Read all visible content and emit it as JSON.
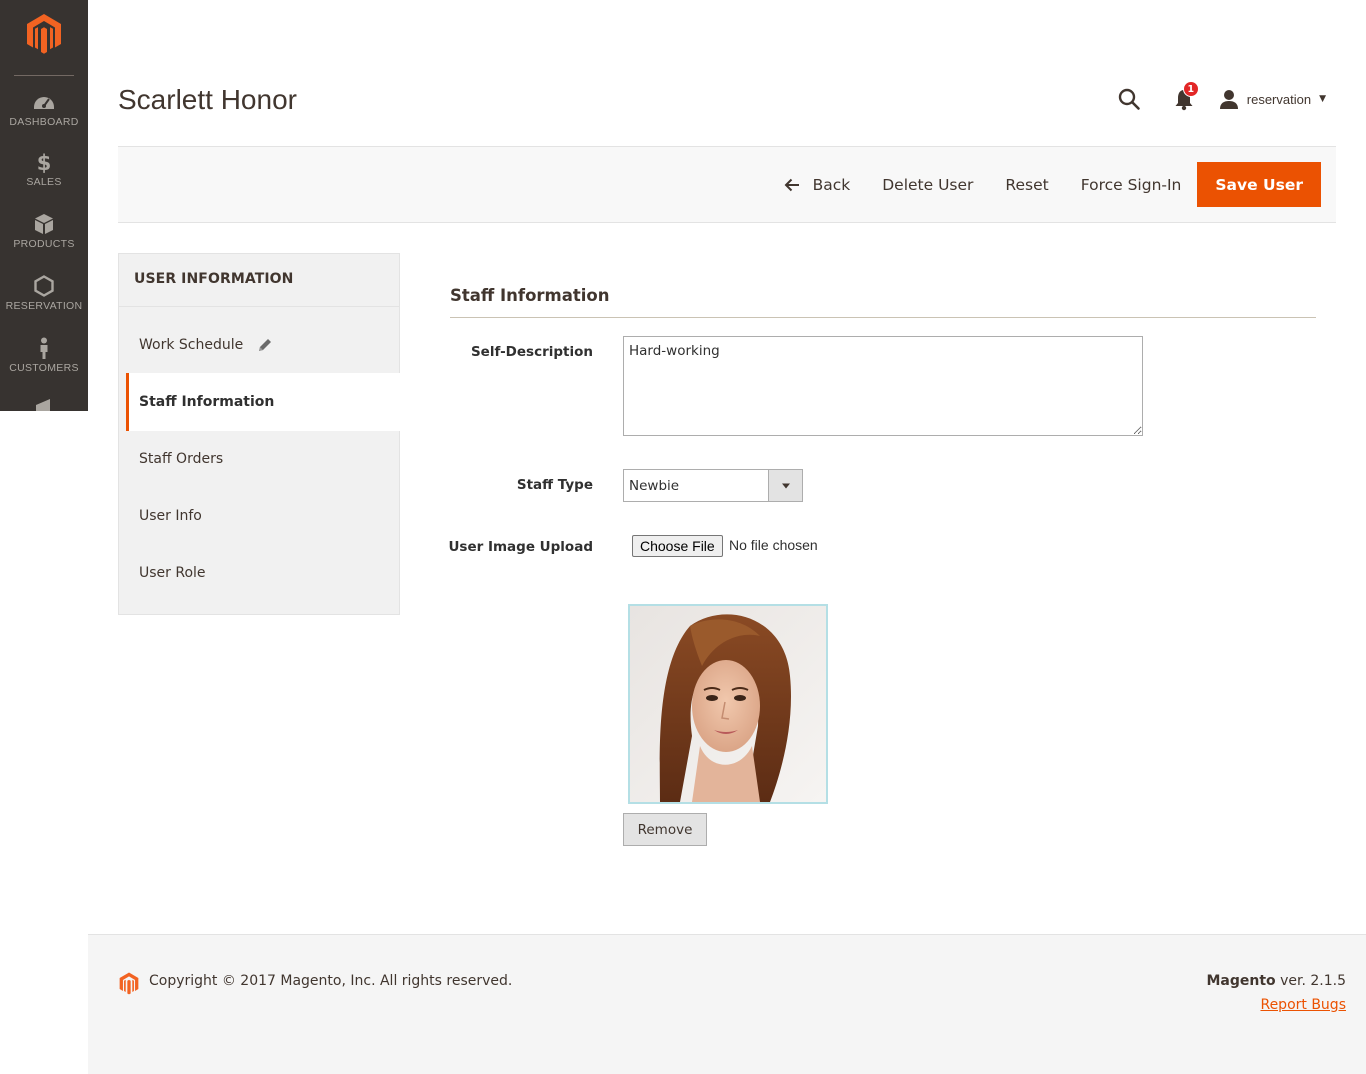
{
  "sidebar": {
    "items": [
      {
        "label": "DASHBOARD",
        "icon": "speedometer-icon"
      },
      {
        "label": "SALES",
        "icon": "dollar-icon"
      },
      {
        "label": "PRODUCTS",
        "icon": "box-icon"
      },
      {
        "label": "RESERVATION",
        "icon": "hexagon-icon"
      },
      {
        "label": "CUSTOMERS",
        "icon": "person-icon"
      }
    ]
  },
  "header": {
    "title": "Scarlett Honor",
    "notification_count": "1",
    "username": "reservation"
  },
  "actions": {
    "back": "Back",
    "delete": "Delete User",
    "reset": "Reset",
    "force_signin": "Force Sign-In",
    "save": "Save User"
  },
  "tabs": {
    "title": "USER INFORMATION",
    "items": [
      {
        "label": "Work Schedule"
      },
      {
        "label": "Staff Information"
      },
      {
        "label": "Staff Orders"
      },
      {
        "label": "User Info"
      },
      {
        "label": "User Role"
      }
    ]
  },
  "form": {
    "section_title": "Staff Information",
    "self_description_label": "Self-Description",
    "self_description_value": "Hard-working",
    "staff_type_label": "Staff Type",
    "staff_type_value": "Newbie",
    "image_upload_label": "User Image Upload",
    "choose_file": "Choose File",
    "file_status": "No file chosen",
    "remove": "Remove"
  },
  "footer": {
    "copyright": "Copyright © 2017 Magento, Inc. All rights reserved.",
    "brand": "Magento",
    "version": " ver. 2.1.5",
    "report_bugs": "Report Bugs"
  },
  "colors": {
    "accent": "#eb5202",
    "sidebar_bg": "#373330",
    "badge": "#e22626"
  }
}
